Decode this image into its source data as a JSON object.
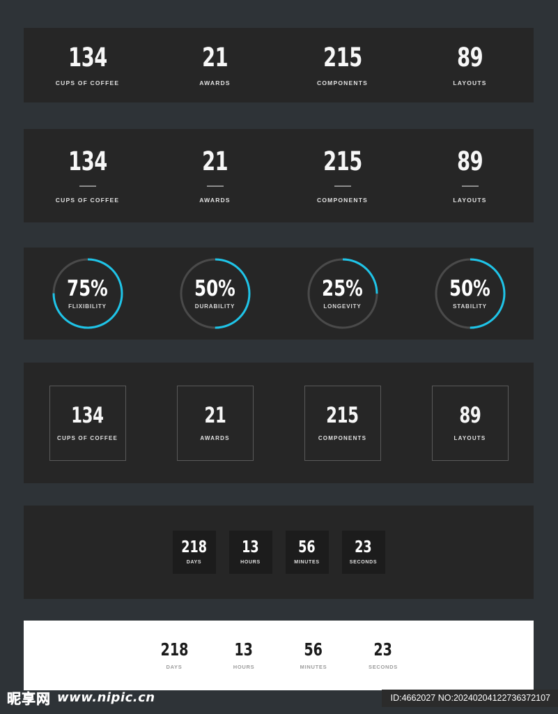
{
  "sections": {
    "counters_plain": {
      "items": [
        {
          "value": "134",
          "label": "CUPS OF COFFEE"
        },
        {
          "value": "21",
          "label": "AWARDS"
        },
        {
          "value": "215",
          "label": "COMPONENTS"
        },
        {
          "value": "89",
          "label": "LAYOUTS"
        }
      ]
    },
    "counters_divider": {
      "items": [
        {
          "value": "134",
          "label": "CUPS OF COFFEE"
        },
        {
          "value": "21",
          "label": "AWARDS"
        },
        {
          "value": "215",
          "label": "COMPONENTS"
        },
        {
          "value": "89",
          "label": "LAYOUTS"
        }
      ]
    },
    "progress_circles": {
      "accent_color": "#1ec4e8",
      "track_color": "#4a4a4a",
      "items": [
        {
          "value": "75%",
          "percent": 75,
          "label": "FLIXIBILITY"
        },
        {
          "value": "50%",
          "percent": 50,
          "label": "DURABILITY"
        },
        {
          "value": "25%",
          "percent": 25,
          "label": "LONGEVITY"
        },
        {
          "value": "50%",
          "percent": 50,
          "label": "STABILITY"
        }
      ]
    },
    "counters_boxed": {
      "items": [
        {
          "value": "134",
          "label": "CUPS OF COFFEE"
        },
        {
          "value": "21",
          "label": "AWARDS"
        },
        {
          "value": "215",
          "label": "COMPONENTS"
        },
        {
          "value": "89",
          "label": "LAYOUTS"
        }
      ]
    },
    "countdown_dark": {
      "items": [
        {
          "value": "218",
          "label": "DAYS"
        },
        {
          "value": "13",
          "label": "HOURS"
        },
        {
          "value": "56",
          "label": "MINUTES"
        },
        {
          "value": "23",
          "label": "SECONDS"
        }
      ]
    },
    "countdown_light": {
      "items": [
        {
          "value": "218",
          "label": "DAYS"
        },
        {
          "value": "13",
          "label": "HOURS"
        },
        {
          "value": "56",
          "label": "MINUTES"
        },
        {
          "value": "23",
          "label": "SECONDS"
        }
      ]
    }
  },
  "footer": {
    "watermark_cn": "昵享网",
    "watermark_url": "www.nipic.cn",
    "id_text": "ID:4662027 NO:20240204122736372107"
  }
}
